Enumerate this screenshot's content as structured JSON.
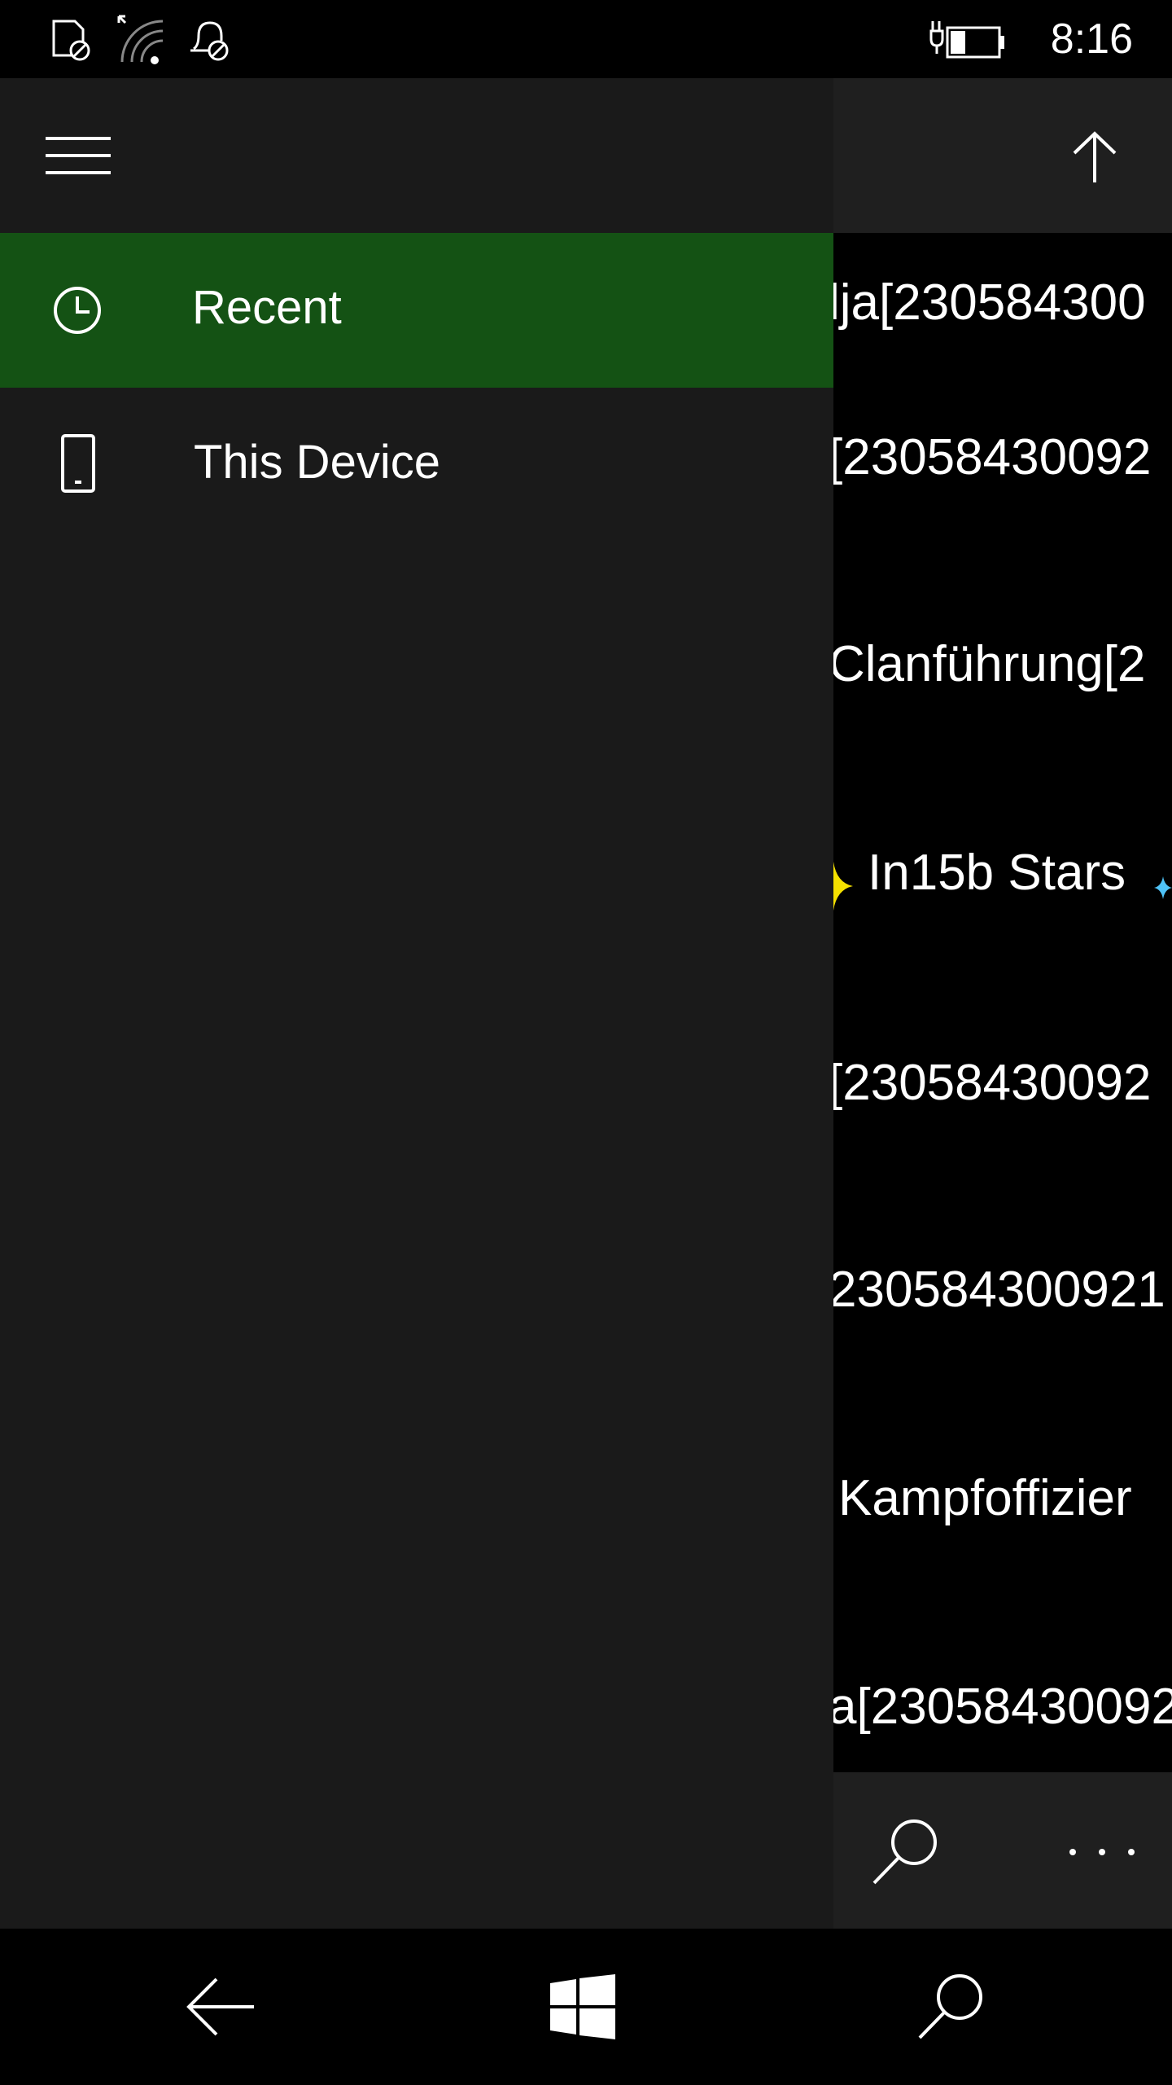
{
  "status_bar": {
    "time": "8:16",
    "icons": [
      "no-sim-icon",
      "wifi-signal-icon",
      "quiet-hours-icon",
      "battery-charging-icon"
    ]
  },
  "nav_pane": {
    "menu_icon": "hamburger-menu-icon",
    "items": [
      {
        "label": "Recent",
        "icon": "clock-icon",
        "selected": true
      },
      {
        "label": "This Device",
        "icon": "phone-device-icon",
        "selected": false
      }
    ],
    "accent_color": "#145214"
  },
  "content": {
    "up_icon": "up-arrow-icon",
    "files": [
      {
        "name": "lja[230584300"
      },
      {
        "name": "[23058430092"
      },
      {
        "name": "Clanführung[2"
      },
      {
        "name": "In15b Stars"
      },
      {
        "name": "[23058430092"
      },
      {
        "name": "230584300921"
      },
      {
        "name": "Kampfoffizier"
      },
      {
        "name": "a[23058430092"
      }
    ],
    "appbar": {
      "search_icon": "search-icon",
      "more_icon": "more-ellipsis-icon"
    }
  },
  "system_nav": {
    "icons": [
      "back-icon",
      "windows-start-icon",
      "search-icon"
    ]
  }
}
